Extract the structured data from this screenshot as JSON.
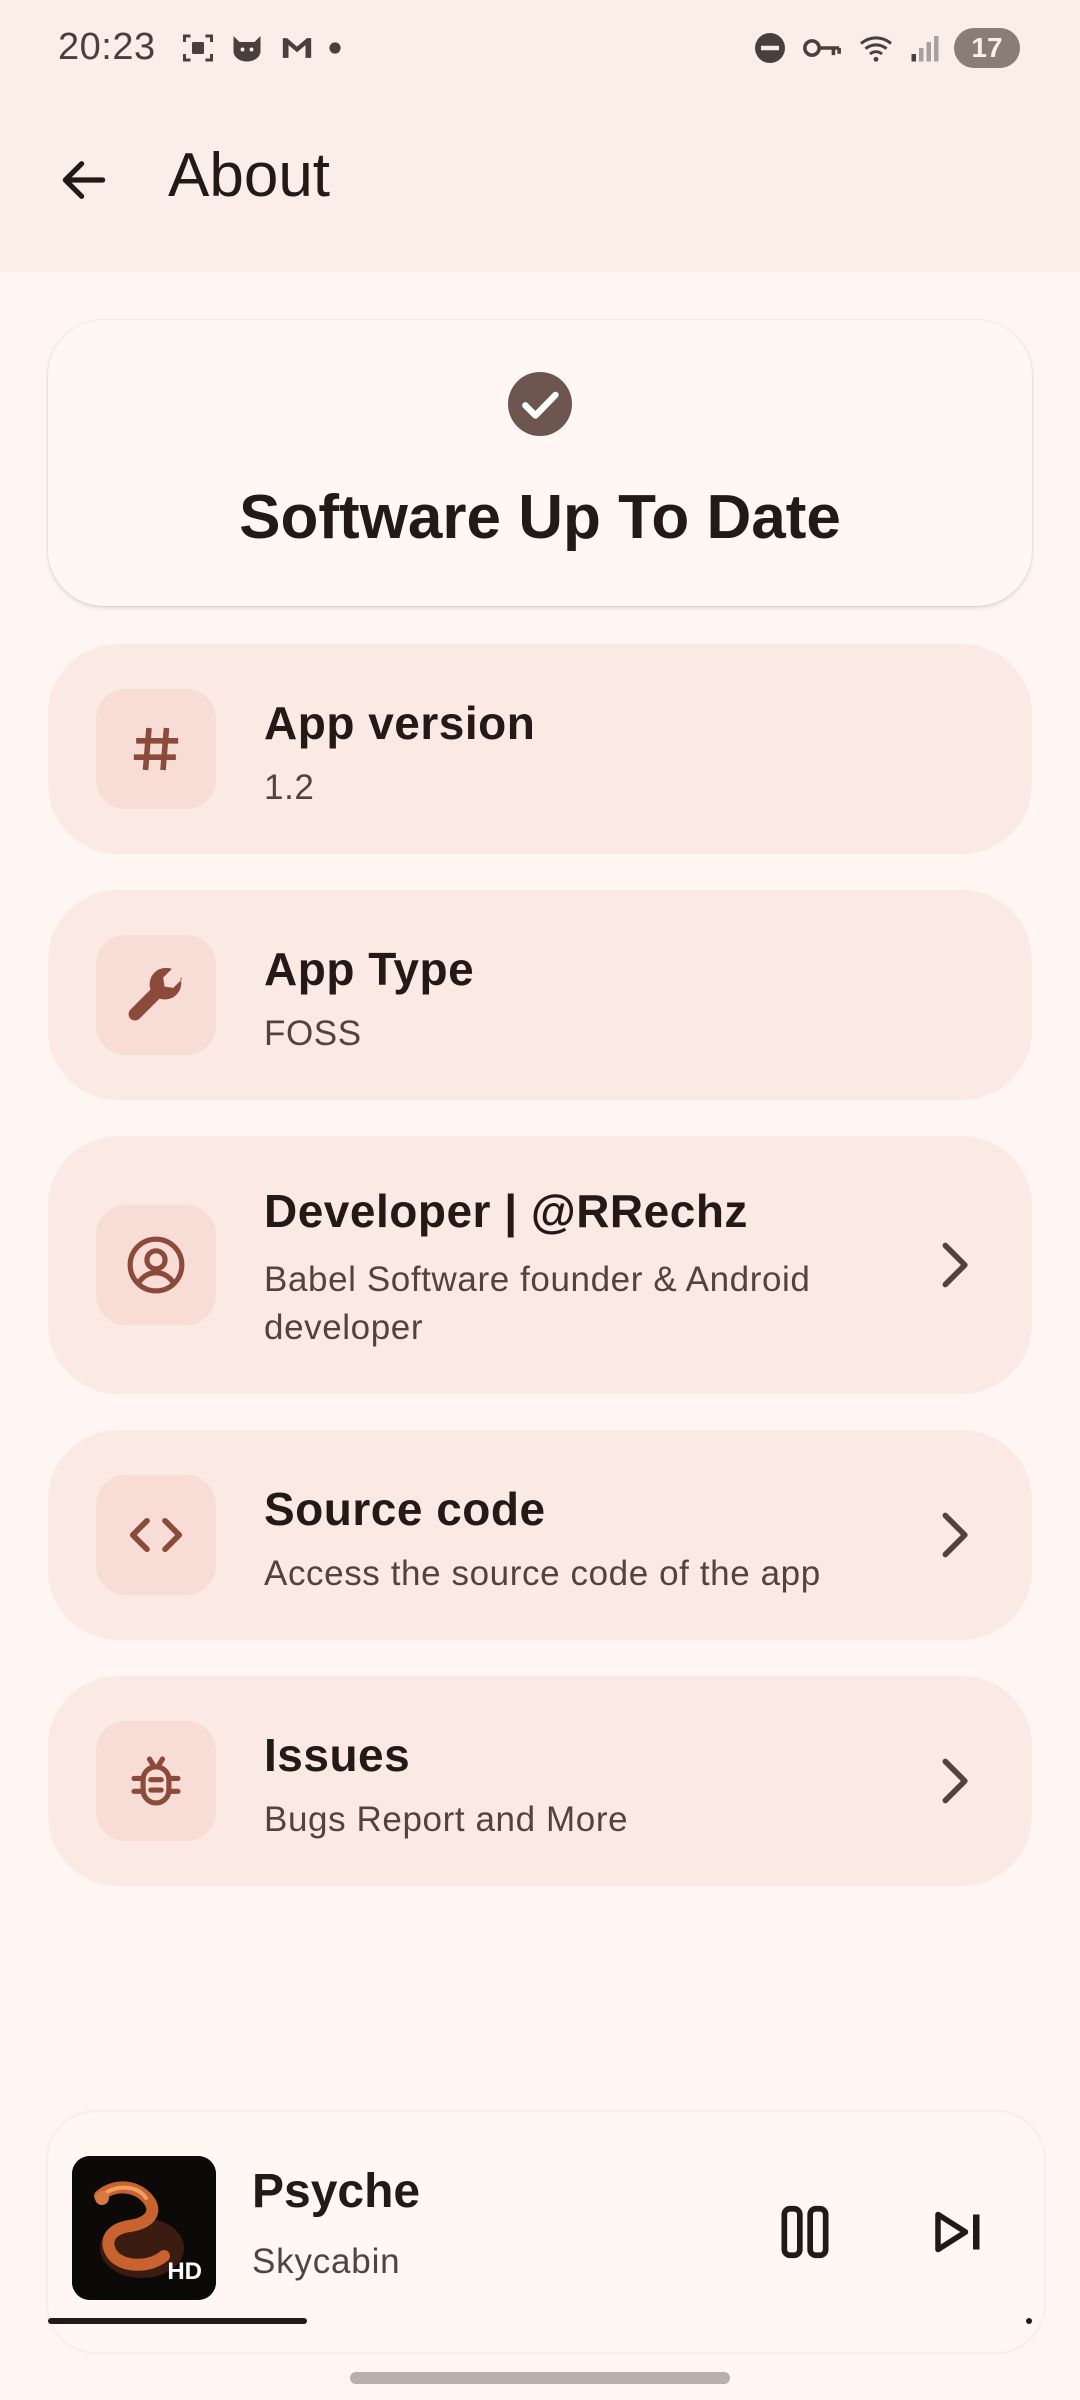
{
  "status_bar": {
    "time": "20:23",
    "battery": "17",
    "left_icons": [
      "screenshot-icon",
      "cat-icon",
      "gmail-icon",
      "dot-icon"
    ],
    "right_icons": [
      "dnd-icon",
      "vpn-key-icon",
      "wifi-icon",
      "signal-icon"
    ]
  },
  "header": {
    "title": "About"
  },
  "update_card": {
    "title": "Software Up To Date",
    "icon": "check-circle-icon"
  },
  "items": [
    {
      "title": "App version",
      "subtitle": "1.2",
      "icon": "hash-icon"
    },
    {
      "title": "App Type",
      "subtitle": "FOSS",
      "icon": "wrench-icon"
    },
    {
      "title": "Developer | @RRechz",
      "subtitle": "Babel Software founder & Android developer",
      "icon": "account-icon"
    },
    {
      "title": "Source code",
      "subtitle": "Access the source code of the app",
      "icon": "code-icon"
    },
    {
      "title": "Issues",
      "subtitle": "Bugs Report and More",
      "icon": "bug-icon"
    }
  ],
  "player": {
    "title": "Psyche",
    "artist": "Skycabin",
    "badge": "HD",
    "progress": 0.26
  },
  "colors": {
    "accent": "#8b4a3a",
    "background": "#fff5f2",
    "card": "#fbe9e4",
    "icon_box": "#f7ddd6"
  }
}
